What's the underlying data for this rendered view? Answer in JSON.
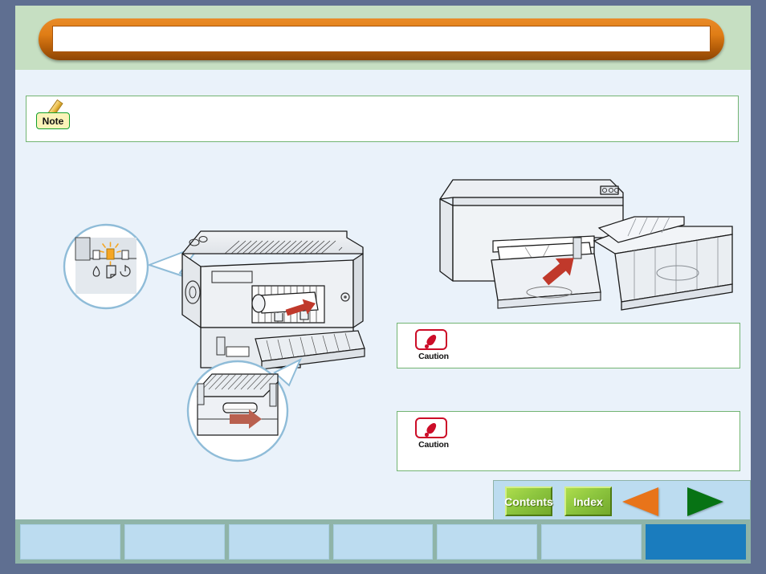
{
  "page": {
    "title": "",
    "accent_orange": "#e07d16",
    "accent_green": "#72b472",
    "frame_color": "#5f6f91",
    "header_band_color": "#c6dfc2",
    "content_bg": "#eaf2fa"
  },
  "note": {
    "badge_label": "Note",
    "badge_icon": "pencil-icon",
    "text": ""
  },
  "cautions": [
    {
      "badge_label": "Caution",
      "badge_icon": "exclamation-icon",
      "text": ""
    },
    {
      "badge_label": "Caution",
      "badge_icon": "exclamation-icon",
      "text": ""
    }
  ],
  "illustrations": {
    "left": {
      "name": "printer-rear-paper-jam-diagram",
      "callouts": [
        {
          "name": "control-panel-lights-callout",
          "lights": [
            {
              "name": "ink-light",
              "icon": "ink-drop-icon",
              "state": "off"
            },
            {
              "name": "paper-light",
              "icon": "paper-sheet-icon",
              "state": "blinking",
              "color": "#f5a623"
            },
            {
              "name": "power-light",
              "icon": "power-icon",
              "state": "off"
            }
          ]
        },
        {
          "name": "rear-cover-lever-callout",
          "arrow": {
            "name": "release-lever-arrow",
            "direction": "right",
            "color": "#b9604f"
          }
        }
      ],
      "arrow": {
        "name": "pull-paper-arrow",
        "direction": "up-right",
        "color": "#c0392b"
      }
    },
    "right": {
      "name": "printer-front-paper-tray-diagram",
      "arrow": {
        "name": "paper-feed-arrow",
        "direction": "up-right",
        "color": "#c0392b"
      }
    }
  },
  "nav": {
    "contents_label": "Contents",
    "index_label": "Index",
    "prev_icon": "triangle-left-icon",
    "next_icon": "triangle-right-icon",
    "prev_color": "#e8741a",
    "next_color": "#077314"
  },
  "tabs": [
    {
      "label": "",
      "active": false
    },
    {
      "label": "",
      "active": false
    },
    {
      "label": "",
      "active": false
    },
    {
      "label": "",
      "active": false
    },
    {
      "label": "",
      "active": false
    },
    {
      "label": "",
      "active": false
    },
    {
      "label": "",
      "active": true
    }
  ]
}
